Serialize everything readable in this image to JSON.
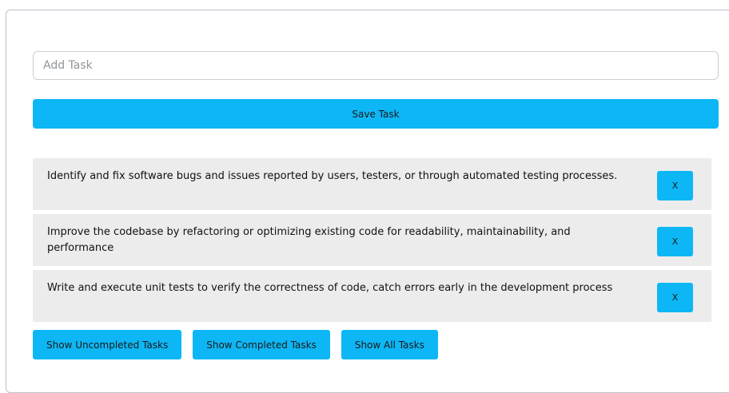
{
  "input": {
    "placeholder": "Add Task",
    "value": ""
  },
  "save_button": {
    "label": "Save Task"
  },
  "tasks": [
    {
      "text": "Identify and fix software bugs and issues reported by users, testers, or through automated testing processes.",
      "delete_label": "X"
    },
    {
      "text": "Improve the codebase by refactoring or optimizing existing code for readability, maintainability, and performance",
      "delete_label": "X"
    },
    {
      "text": "Write and execute unit tests to verify the correctness of code, catch errors early in the development process",
      "delete_label": "X"
    }
  ],
  "filters": [
    {
      "label": "Show Uncompleted Tasks"
    },
    {
      "label": "Show Completed Tasks"
    },
    {
      "label": "Show All Tasks"
    }
  ],
  "colors": {
    "accent": "#0db7f5",
    "task_background": "#ececec",
    "border": "#b9c3cc"
  }
}
